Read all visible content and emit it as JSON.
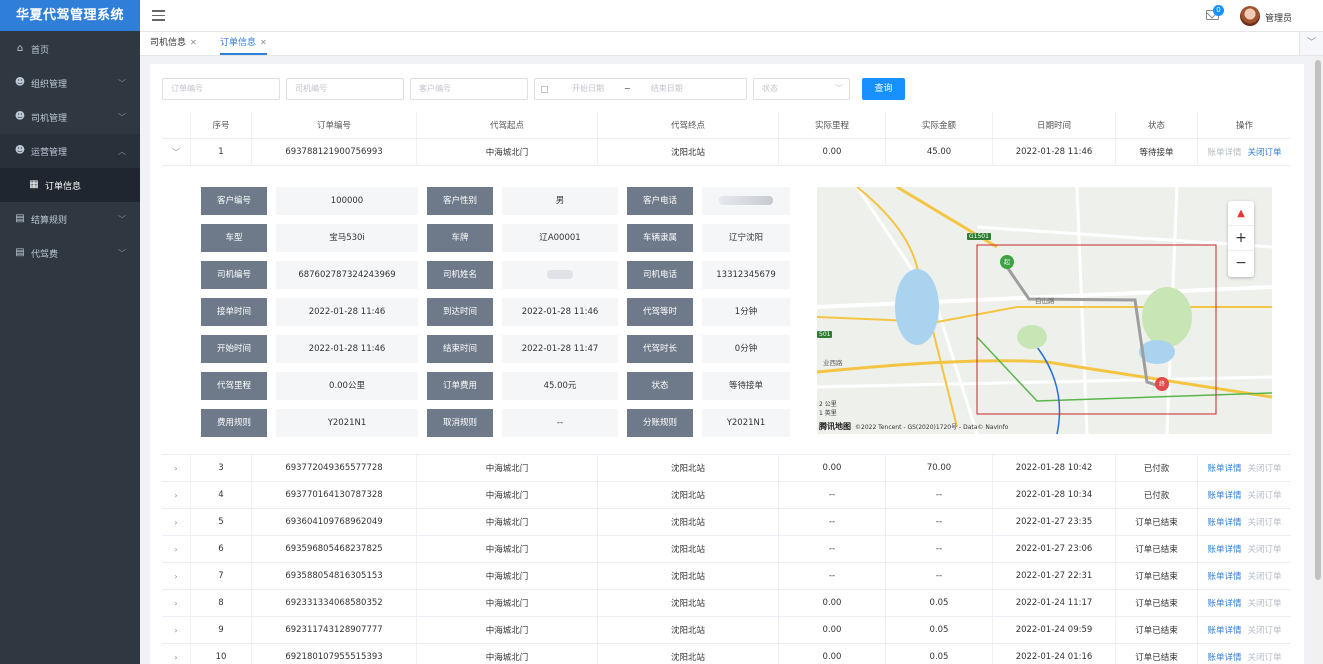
{
  "app": {
    "title": "华夏代驾管理系统"
  },
  "sidebar": {
    "items": [
      {
        "label": "首页",
        "icon": "home-icon"
      },
      {
        "label": "组织管理",
        "icon": "people-icon"
      },
      {
        "label": "司机管理",
        "icon": "people-icon"
      },
      {
        "label": "运营管理",
        "icon": "people-icon",
        "open": true
      },
      {
        "label": "结算规则",
        "icon": "monitor-icon"
      },
      {
        "label": "代驾费",
        "icon": "monitor-icon"
      }
    ],
    "sub_item": {
      "label": "订单信息",
      "icon": "table-icon"
    }
  },
  "header": {
    "mail_badge": "0",
    "username": "管理员"
  },
  "tabs": [
    {
      "label": "司机信息",
      "active": false
    },
    {
      "label": "订单信息",
      "active": true
    }
  ],
  "filter": {
    "order_no_placeholder": "订单编号",
    "driver_no_placeholder": "司机编号",
    "customer_no_placeholder": "客户编号",
    "start_date_placeholder": "开始日期",
    "date_sep": "~",
    "end_date_placeholder": "结束日期",
    "status_placeholder": "状态",
    "query_label": "查询"
  },
  "table": {
    "headers": [
      "序号",
      "订单编号",
      "代驾起点",
      "代驾终点",
      "实际里程",
      "实际金额",
      "日期时间",
      "状态",
      "操作"
    ],
    "expanded_row": {
      "index": "1",
      "order_no": "693788121900756993",
      "start": "中海城北门",
      "end": "沈阳北站",
      "mileage": "0.00",
      "amount": "45.00",
      "datetime": "2022-01-28 11:46",
      "status": "等待接单",
      "op1": "账单详情",
      "op2": "关闭订单"
    },
    "detail": {
      "rows": [
        [
          [
            "客户编号",
            "100000"
          ],
          [
            "客户性别",
            "男"
          ],
          [
            "客户电话",
            ""
          ]
        ],
        [
          [
            "车型",
            "宝马530i"
          ],
          [
            "车牌",
            "辽A00001"
          ],
          [
            "车辆隶属",
            "辽宁沈阳"
          ]
        ],
        [
          [
            "司机编号",
            "687602787324243969"
          ],
          [
            "司机姓名",
            ""
          ],
          [
            "司机电话",
            "13312345679"
          ]
        ],
        [
          [
            "接单时间",
            "2022-01-28 11:46"
          ],
          [
            "到达时间",
            "2022-01-28 11:46"
          ],
          [
            "代驾等时",
            "1分钟"
          ]
        ],
        [
          [
            "开始时间",
            "2022-01-28 11:46"
          ],
          [
            "结束时间",
            "2022-01-28 11:47"
          ],
          [
            "代驾时长",
            "0分钟"
          ]
        ],
        [
          [
            "代驾里程",
            "0.00公里"
          ],
          [
            "订单费用",
            "45.00元"
          ],
          [
            "状态",
            "等待接单"
          ]
        ],
        [
          [
            "费用规则",
            "Y2021N1"
          ],
          [
            "取消规则",
            "--"
          ],
          [
            "分账规则",
            "Y2021N1"
          ]
        ]
      ],
      "map": {
        "road_label": "白山路",
        "highway_badge": "G1501",
        "highway_badge_2": "501",
        "area_label": "业西路",
        "scale_top": "2 公里",
        "scale_bottom": "1 英里",
        "logo": "腾讯地图",
        "copyright": "©2022 Tencent - GS(2020)1720号 - Data© NavInfo",
        "start_marker": "起",
        "end_marker": "终"
      }
    },
    "rows": [
      {
        "index": "3",
        "order_no": "693772049365577728",
        "start": "中海城北门",
        "end": "沈阳北站",
        "mileage": "0.00",
        "amount": "70.00",
        "datetime": "2022-01-28 10:42",
        "status": "已付款",
        "op1": "账单详情",
        "op2": "关闭订单"
      },
      {
        "index": "4",
        "order_no": "693770164130787328",
        "start": "中海城北门",
        "end": "沈阳北站",
        "mileage": "--",
        "amount": "--",
        "datetime": "2022-01-28 10:34",
        "status": "已付款",
        "op1": "账单详情",
        "op2": "关闭订单"
      },
      {
        "index": "5",
        "order_no": "693604109768962049",
        "start": "中海城北门",
        "end": "沈阳北站",
        "mileage": "--",
        "amount": "--",
        "datetime": "2022-01-27 23:35",
        "status": "订单已结束",
        "op1": "账单详情",
        "op2": "关闭订单"
      },
      {
        "index": "6",
        "order_no": "693596805468237825",
        "start": "中海城北门",
        "end": "沈阳北站",
        "mileage": "--",
        "amount": "--",
        "datetime": "2022-01-27 23:06",
        "status": "订单已结束",
        "op1": "账单详情",
        "op2": "关闭订单"
      },
      {
        "index": "7",
        "order_no": "693588054816305153",
        "start": "中海城北门",
        "end": "沈阳北站",
        "mileage": "--",
        "amount": "--",
        "datetime": "2022-01-27 22:31",
        "status": "订单已结束",
        "op1": "账单详情",
        "op2": "关闭订单"
      },
      {
        "index": "8",
        "order_no": "692331334068580352",
        "start": "中海城北门",
        "end": "沈阳北站",
        "mileage": "0.00",
        "amount": "0.05",
        "datetime": "2022-01-24 11:17",
        "status": "订单已结束",
        "op1": "账单详情",
        "op2": "关闭订单"
      },
      {
        "index": "9",
        "order_no": "692311743128907777",
        "start": "中海城北门",
        "end": "沈阳北站",
        "mileage": "0.00",
        "amount": "0.05",
        "datetime": "2022-01-24 09:59",
        "status": "订单已结束",
        "op1": "账单详情",
        "op2": "关闭订单"
      },
      {
        "index": "10",
        "order_no": "692180107955515393",
        "start": "中海城北门",
        "end": "沈阳北站",
        "mileage": "0.00",
        "amount": "0.05",
        "datetime": "2022-01-24 01:16",
        "status": "订单已结束",
        "op1": "账单详情",
        "op2": "关闭订单"
      }
    ]
  },
  "colors": {
    "accent": "#2f7ed8",
    "sidebar_bg": "#2f3740",
    "label_bg": "#6e7a8a"
  }
}
